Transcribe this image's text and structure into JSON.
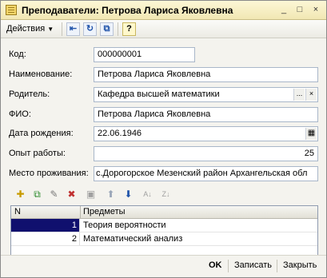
{
  "window": {
    "title": "Преподаватели: Петрова Лариса Яковлевна",
    "controls": [
      "_",
      "□",
      "×"
    ]
  },
  "toolbar": {
    "actions_label": "Действия",
    "icons": [
      "arrow-left-icon",
      "refresh-icon",
      "copy-icon",
      "help-icon"
    ],
    "help_glyph": "?"
  },
  "form": {
    "code": {
      "label": "Код:",
      "value": "000000001"
    },
    "name": {
      "label": "Наименование:",
      "value": "Петрова Лариса Яковлевна"
    },
    "parent": {
      "label": "Родитель:",
      "value": "Кафедра высшей математики",
      "btn1": "...",
      "btn2": "×"
    },
    "fio": {
      "label": "ФИО:",
      "value": "Петрова Лариса Яковлевна"
    },
    "birthdate": {
      "label": "Дата рождения:",
      "value": "22.06.1946"
    },
    "experience": {
      "label": "Опыт работы:",
      "value": "25"
    },
    "residence": {
      "label": "Место проживания:",
      "value": "с.Дорогорское Мезенский район Архангельская обл"
    }
  },
  "subjects_table": {
    "toolbar_icons": [
      "add-row-icon",
      "copy-row-icon",
      "edit-row-icon",
      "delete-row-icon",
      "end-edit-icon",
      "move-up-icon",
      "move-down-icon",
      "sort-asc-icon",
      "sort-desc-icon"
    ],
    "columns": [
      "N",
      "Предметы"
    ],
    "rows": [
      {
        "n": "1",
        "subject": "Теория вероятности"
      },
      {
        "n": "2",
        "subject": "Математический анализ"
      }
    ]
  },
  "footer": {
    "ok_label": "OK",
    "save_label": "Записать",
    "close_label": "Закрыть"
  },
  "colors": {
    "title_bar": "#f1e7b3",
    "selection": "#10106e",
    "field_border": "#a9b7c9"
  }
}
